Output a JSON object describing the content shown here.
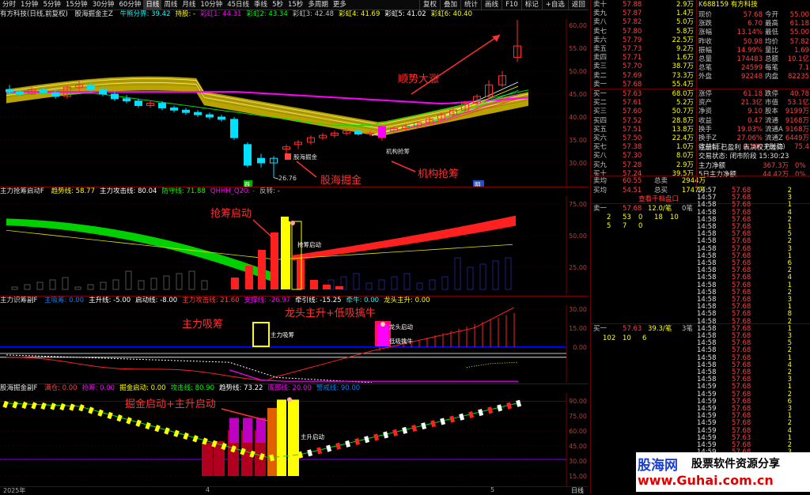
{
  "toolbar": {
    "items": [
      "分时",
      "1分钟",
      "5分钟",
      "15分钟",
      "30分钟",
      "60分钟",
      "日线",
      "周线",
      "月线",
      "10分钟",
      "45日线",
      "季线",
      "5秒",
      "15秒",
      "多周期",
      "更多"
    ],
    "right": [
      "复权",
      "叠加",
      "统计",
      "画线",
      "F10",
      "标记",
      "+自选",
      "返回"
    ]
  },
  "main_panel": {
    "title": "有方科技(日线,前复权)",
    "indicator": "股海掘金主Z",
    "items": [
      {
        "t": "牛熊分界: 39.42",
        "c": "#00ffff"
      },
      {
        "t": "持股: -",
        "c": "#ffff00"
      },
      {
        "t": "彩虹1: 44.31",
        "c": "#ff00ff"
      },
      {
        "t": "彩虹2: 43.34",
        "c": "#00ff00"
      },
      {
        "t": "彩虹3: 42.48",
        "c": "#c0c0c0"
      },
      {
        "t": "彩虹4: 41.69",
        "c": "#ffff00"
      },
      {
        "t": "彩虹5: 41.02",
        "c": "#ffffff"
      },
      {
        "t": "彩虹6: 40.40",
        "c": "#ffff00"
      }
    ],
    "yticks": [
      "60.00",
      "55.00",
      "50.00",
      "45.00",
      "40.00",
      "35.00",
      "30.00"
    ],
    "high_label": "61.18",
    "low_label": "26.76",
    "annotations": {
      "trend": "顺势大涨",
      "dig": "股海掘金",
      "grab": "机构抢筹",
      "small_dig": "股海掘金",
      "small_grab": "机构抢筹"
    },
    "badge_left": "跌",
    "badge_right": "明"
  },
  "panel2": {
    "title": "主力抢筹启动F",
    "items": [
      {
        "t": "趋势线: 58.77",
        "c": "#ffff00"
      },
      {
        "t": "主力攻击线: 80.04",
        "c": "#ffffff"
      },
      {
        "t": "防守线: 71.88",
        "c": "#00ff00"
      },
      {
        "t": "QHHH_Q20: -",
        "c": "#ff00ff"
      },
      {
        "t": "反转: -",
        "c": "#c0c0c0"
      }
    ],
    "yticks": [
      "75.00",
      "50.00",
      "25.00"
    ],
    "annotation": "抢筹启动",
    "small": "抢筹启动"
  },
  "panel3": {
    "title": "主力识筹副F",
    "items": [
      {
        "t": "主吸筹: 0.00",
        "c": "#0080ff"
      },
      {
        "t": "主升线: -5.00",
        "c": "#ffffff"
      },
      {
        "t": "启动线: -8.00",
        "c": "#ffffff"
      },
      {
        "t": "主力攻击线: 21.60",
        "c": "#ff4040"
      },
      {
        "t": "支撑线: -26.97",
        "c": "#ff00ff"
      },
      {
        "t": "牵引线: -15.25",
        "c": "#ffffff"
      },
      {
        "t": "牵牛: 0.00",
        "c": "#00ffff"
      },
      {
        "t": "龙头主升: 0.00",
        "c": "#ffff00"
      }
    ],
    "yticks": [
      "30.00",
      "15.00",
      "0.00"
    ],
    "annotation_left": "主力吸筹",
    "annotation_right": "龙头主升+低吸擒牛",
    "small1": "主力吸筹",
    "small2": "龙头启动",
    "small3": "低吸擒牛"
  },
  "panel4": {
    "title": "股海掘金副F",
    "items": [
      {
        "t": "满仓: 0.00",
        "c": "#ff4040"
      },
      {
        "t": "抢筹: 0.00",
        "c": "#ff00ff"
      },
      {
        "t": "掘金启动: 0.00",
        "c": "#ffff00"
      },
      {
        "t": "攻击线: 80.90",
        "c": "#00ff00"
      },
      {
        "t": "趋势线: 73.22",
        "c": "#ffffff"
      },
      {
        "t": "底部线: 20.00",
        "c": "#ff00ff"
      },
      {
        "t": "警戒线: 90.00",
        "c": "#0080ff"
      }
    ],
    "yticks": [
      "90.00",
      "75.00",
      "60.00",
      "45.00",
      "30.00",
      "15.00"
    ],
    "annotation": "掘金启动+主升启动",
    "small": "主升启动"
  },
  "xaxis": {
    "labels": [
      "2025年",
      "4",
      "5"
    ],
    "period": "日线"
  },
  "quote": {
    "asks": [
      {
        "n": "卖十",
        "p": "57.88",
        "v": "2.9万"
      },
      {
        "n": "卖九",
        "p": "57.87",
        "v": "1.4万"
      },
      {
        "n": "卖八",
        "p": "57.82",
        "v": "5.0万"
      },
      {
        "n": "卖七",
        "p": "57.80",
        "v": "5.8万"
      },
      {
        "n": "卖六",
        "p": "57.79",
        "v": "22.5万"
      },
      {
        "n": "卖五",
        "p": "57.73",
        "v": "9.2万"
      },
      {
        "n": "卖四",
        "p": "57.71",
        "v": "1.6万"
      },
      {
        "n": "卖三",
        "p": "57.70",
        "v": "38.7万"
      },
      {
        "n": "卖二",
        "p": "57.69",
        "v": "73.3万"
      },
      {
        "n": "卖一",
        "p": "57.68",
        "v": "55.4万"
      }
    ],
    "bids": [
      {
        "n": "买一",
        "p": "57.63",
        "v": "68.0万"
      },
      {
        "n": "买二",
        "p": "57.61",
        "v": "5.2万"
      },
      {
        "n": "买三",
        "p": "57.60",
        "v": "50.7万"
      },
      {
        "n": "买四",
        "p": "57.52",
        "v": "28.8万"
      },
      {
        "n": "买五",
        "p": "57.51",
        "v": "13.8万"
      },
      {
        "n": "买六",
        "p": "57.50",
        "v": "22.4万"
      },
      {
        "n": "买七",
        "p": "57.38",
        "v": "1.0万"
      },
      {
        "n": "买八",
        "p": "57.30",
        "v": "8.0万"
      },
      {
        "n": "买九",
        "p": "57.28",
        "v": "2.9万"
      },
      {
        "n": "买十",
        "p": "57.24",
        "v": "39.5万"
      }
    ],
    "sum1": {
      "a": "卖均",
      "b": "60.55",
      "c": "总卖",
      "d": "2944万"
    },
    "sum2": {
      "a": "买均",
      "b": "54.51",
      "c": "总买",
      "d": "1747万"
    },
    "detail_link": "查看千档盘口",
    "q1": {
      "a": "卖一",
      "b": "57.68",
      "c": "12.0/笔",
      "d": "0笔"
    },
    "q1vals": [
      "2",
      "53",
      "0",
      "18",
      "10"
    ],
    "q1vals2": [
      "5",
      "7",
      "0"
    ],
    "q2": {
      "a": "买一",
      "b": "57.63",
      "c": "39.3/笔",
      "d": "3笔"
    },
    "q2vals": [
      "102",
      "10",
      "6"
    ],
    "code": "688159",
    "name": "有方科技",
    "prefix": "K",
    "stats": [
      {
        "a": "现价",
        "b": "57.68",
        "c": "今开",
        "d": "55.00"
      },
      {
        "a": "涨跌",
        "b": "6.70",
        "c": "最高",
        "d": "61.18"
      },
      {
        "a": "涨幅",
        "b": "13.14%",
        "c": "最低",
        "d": "55.00"
      },
      {
        "a": "昨收",
        "b": "50.98",
        "c": "均价",
        "d": "57.82"
      },
      {
        "a": "振幅",
        "b": "14.99%",
        "c": "量比",
        "d": "1.69"
      },
      {
        "a": "总量",
        "b": "174483",
        "c": "总额",
        "d": "10.1亿"
      },
      {
        "a": "总笔",
        "b": "24599",
        "c": "每笔",
        "d": "7.1"
      },
      {
        "a": "外盘",
        "b": "92248",
        "c": "内盘",
        "d": "82235"
      },
      {
        "a": "涨停",
        "b": "61.18",
        "c": "跌停",
        "d": "40.78"
      },
      {
        "a": "资产",
        "b": "21.3亿",
        "c": "市值",
        "d": "53.1亿"
      },
      {
        "a": "净资",
        "b": "9.10",
        "c": "股本",
        "d": "9199万"
      },
      {
        "a": "收益",
        "b": "0.47",
        "c": "流通",
        "d": "9168万"
      },
      {
        "a": "换手",
        "b": "19.03%",
        "c": "流通A",
        "d": "9168万"
      },
      {
        "a": "换手Z",
        "b": "27.06%",
        "c": "流通Z",
        "d": "6449万"
      },
      {
        "a": "收益(三)",
        "b": "0.190",
        "c": "PE(动)",
        "d": "75.4"
      }
    ],
    "info1": "注册制 已盈利 表决权无差异",
    "info2": "交易状态: 闭市阶段 15:30:23",
    "netflow": [
      {
        "a": "主力净额",
        "b": "367.3万",
        "c": "0%"
      },
      {
        "a": "5日主力净额",
        "b": "44.42万",
        "c": "0%"
      }
    ]
  },
  "ticks": [
    {
      "t": "14:57",
      "p": "57.68",
      "v": "2"
    },
    {
      "t": "14:57",
      "p": "57.68",
      "v": "3"
    },
    {
      "t": "14:58",
      "p": "57.68",
      "v": "1"
    },
    {
      "t": "14:58",
      "p": "57.68",
      "v": "4"
    },
    {
      "t": "14:58",
      "p": "57.68",
      "v": "2"
    },
    {
      "t": "14:58",
      "p": "57.68",
      "v": "1"
    },
    {
      "t": "14:58",
      "p": "57.68",
      "v": "5"
    },
    {
      "t": "14:58",
      "p": "57.68",
      "v": "2"
    },
    {
      "t": "14:58",
      "p": "57.68",
      "v": "3"
    },
    {
      "t": "14:58",
      "p": "57.68",
      "v": "1"
    },
    {
      "t": "14:58",
      "p": "57.68",
      "v": "6"
    },
    {
      "t": "14:58",
      "p": "57.68",
      "v": "2"
    },
    {
      "t": "14:58",
      "p": "57.68",
      "v": "4"
    },
    {
      "t": "14:58",
      "p": "57.68",
      "v": "1"
    },
    {
      "t": "14:58",
      "p": "57.68",
      "v": "2"
    },
    {
      "t": "14:58",
      "p": "57.68",
      "v": "3"
    },
    {
      "t": "14:58",
      "p": "57.68",
      "v": "1"
    },
    {
      "t": "14:58",
      "p": "57.68",
      "v": "8"
    },
    {
      "t": "14:58",
      "p": "57.68",
      "v": "2"
    },
    {
      "t": "14:58",
      "p": "57.68",
      "v": "1"
    },
    {
      "t": "14:58",
      "p": "57.68",
      "v": "3"
    },
    {
      "t": "14:58",
      "p": "57.68",
      "v": "5"
    },
    {
      "t": "14:58",
      "p": "57.68",
      "v": "2"
    },
    {
      "t": "14:58",
      "p": "57.68",
      "v": "1"
    },
    {
      "t": "14:58",
      "p": "57.68",
      "v": "4"
    },
    {
      "t": "14:58",
      "p": "57.68",
      "v": "2"
    },
    {
      "t": "14:58",
      "p": "57.68",
      "v": "3"
    },
    {
      "t": "14:59",
      "p": "57.68",
      "v": "1"
    },
    {
      "t": "14:59",
      "p": "57.68",
      "v": "2"
    },
    {
      "t": "14:59",
      "p": "57.68",
      "v": "6"
    },
    {
      "t": "14:59",
      "p": "57.68",
      "v": "3"
    },
    {
      "t": "14:59",
      "p": "57.68",
      "v": "1"
    },
    {
      "t": "14:59",
      "p": "57.68",
      "v": "2"
    },
    {
      "t": "14:59",
      "p": "57.68",
      "v": "4"
    },
    {
      "t": "14:59",
      "p": "57.63",
      "v": "1"
    },
    {
      "t": "14:59",
      "p": "57.68",
      "v": "2"
    },
    {
      "t": "14:59",
      "p": "57.68",
      "v": "3"
    }
  ],
  "watermark": {
    "brand": "股海网",
    "slogan": "股票软件资源分享",
    "url": "www.Guhai.com.cn"
  }
}
